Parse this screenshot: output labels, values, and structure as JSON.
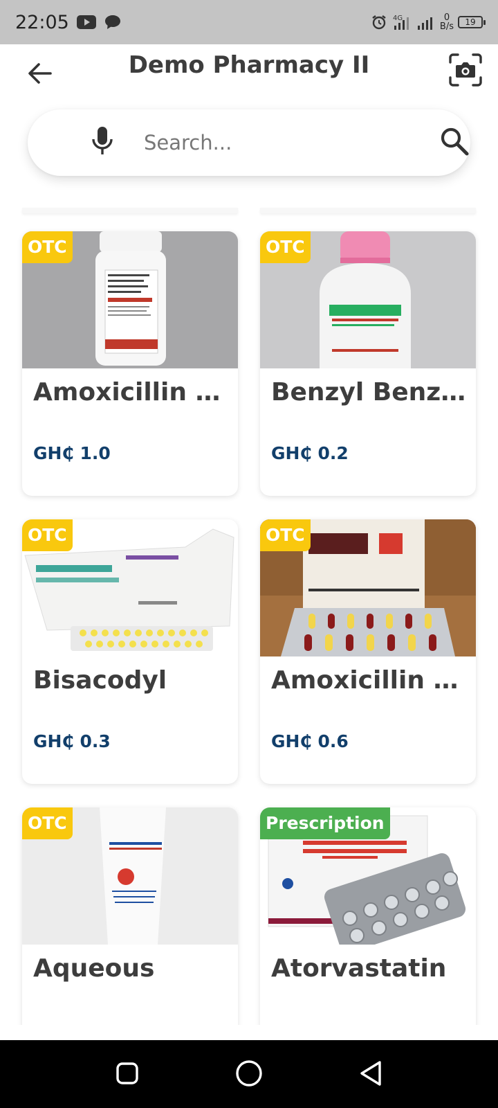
{
  "status_bar": {
    "time": "22:05",
    "left_icons": [
      "youtube-icon",
      "chat-icon"
    ],
    "right_icons": [
      "alarm-icon",
      "signal-4g-icon",
      "signal-icon"
    ],
    "net_speed_value": "0",
    "net_speed_unit": "B/s",
    "battery_level": "19"
  },
  "header": {
    "title": "Demo Pharmacy II",
    "back_icon": "arrow-left-icon",
    "camera_icon": "camera-icon"
  },
  "search": {
    "placeholder": "Search...",
    "value": "",
    "mic_icon": "microphone-icon",
    "search_icon": "search-icon"
  },
  "products": [
    {
      "badge": "OTC",
      "name": "Amoxicillin +...",
      "price": "GH₵ 1.0"
    },
    {
      "badge": "OTC",
      "name": "Benzyl Benz...",
      "price": "GH₵ 0.2"
    },
    {
      "badge": "OTC",
      "name": "Bisacodyl",
      "price": "GH₵ 0.3"
    },
    {
      "badge": "OTC",
      "name": "Amoxicillin C...",
      "price": "GH₵ 0.6"
    },
    {
      "badge": "OTC",
      "name": "Aqueous",
      "price": ""
    },
    {
      "badge": "Prescription",
      "name": "Atorvastatin",
      "price": ""
    }
  ],
  "colors": {
    "otc_badge": "#f9c80e",
    "prescription_badge": "#4caf50",
    "price_text": "#123f6b",
    "title_text": "#3d3d3d",
    "status_bar": "#c4c4c4"
  },
  "nav_bar": {
    "icons": [
      "recent-apps-icon",
      "home-icon",
      "back-triangle-icon"
    ]
  }
}
